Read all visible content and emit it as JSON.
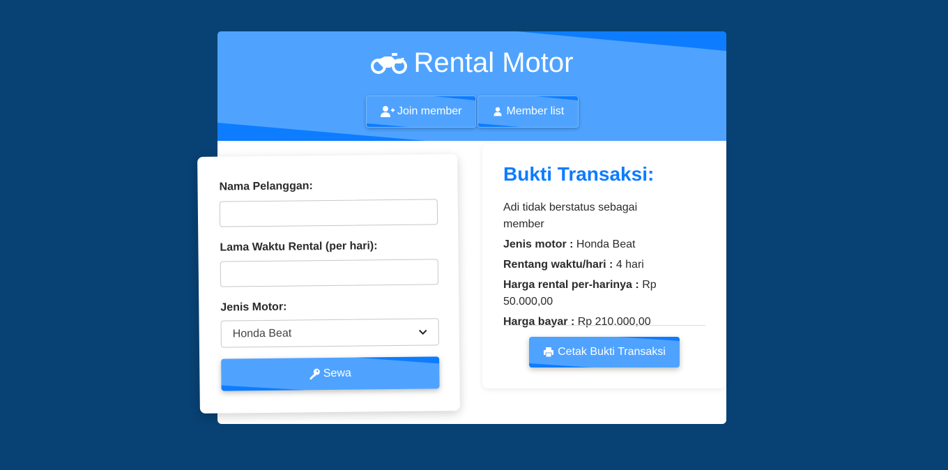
{
  "header": {
    "title": "Rental Motor",
    "title_icon": "motorcycle-icon",
    "buttons": [
      {
        "label": "Join member",
        "icon": "user-plus-icon"
      },
      {
        "label": "Member list",
        "icon": "user-icon"
      }
    ]
  },
  "form": {
    "name_label": "Nama Pelanggan:",
    "name_value": "",
    "duration_label": "Lama Waktu Rental (per hari):",
    "duration_value": "",
    "motor_label": "Jenis Motor:",
    "motor_selected": "Honda Beat",
    "submit_label": "Sewa",
    "submit_icon": "key-icon"
  },
  "receipt": {
    "title": "Bukti Transaksi:",
    "status": "Adi tidak berstatus sebagai member",
    "motor_key": "Jenis motor :",
    "motor_val": "Honda Beat",
    "duration_key": "Rentang waktu/hari :",
    "duration_val": "4 hari",
    "daily_key": "Harga rental per-harinya :",
    "daily_val": "Rp 50.000,00",
    "total_key": "Harga bayar :",
    "total_val": "Rp 210.000,00",
    "print_label": "Cetak Bukti Transaksi",
    "print_icon": "printer-icon"
  },
  "colors": {
    "background": "#084173",
    "primary": "#4fa3ff",
    "accent": "#0d7cff"
  }
}
